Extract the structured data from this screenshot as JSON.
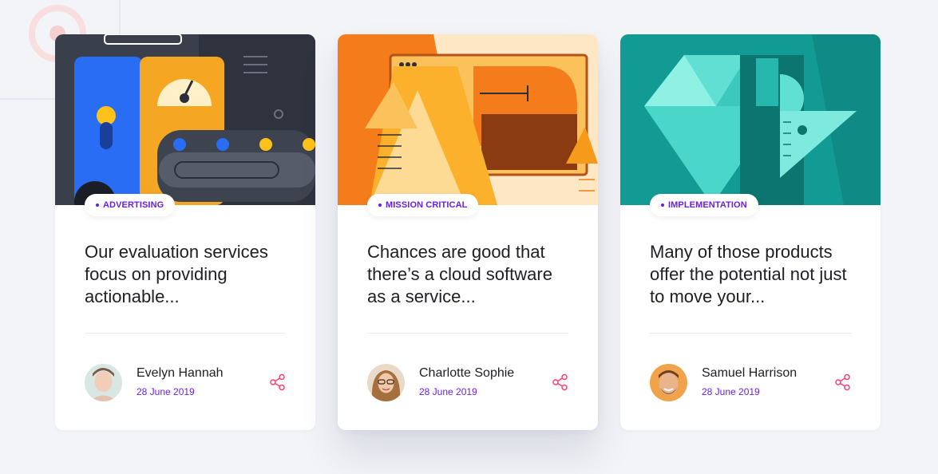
{
  "colors": {
    "accent": "#6a1fe0",
    "share": "#ff3e6c",
    "text": "#1e1e24",
    "background": "#f3f4f8"
  },
  "cards": [
    {
      "tag": "ADVERTISING",
      "title": "Our evaluation services focus on providing actionable...",
      "author": "Evelyn Hannah",
      "date": "28 June 2019",
      "icon": "share-icon"
    },
    {
      "tag": "MISSION CRITICAL",
      "title": "Chances are good that there’s a cloud software as a service...",
      "author": "Charlotte Sophie",
      "date": "28 June 2019",
      "icon": "share-icon"
    },
    {
      "tag": "IMPLEMENTATION",
      "title": "Many of those products offer the potential not just to move your...",
      "author": "Samuel Harrison",
      "date": "28 June 2019",
      "icon": "share-icon"
    }
  ]
}
